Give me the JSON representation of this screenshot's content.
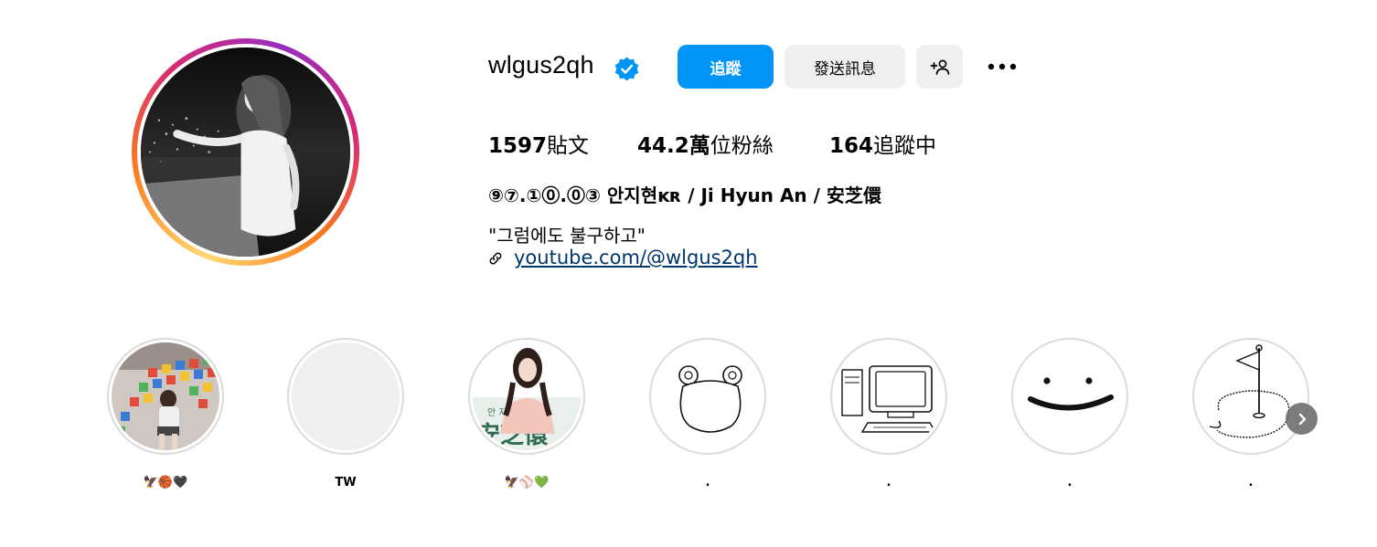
{
  "profile": {
    "username": "wlgus2qh",
    "verified": true,
    "accent_color": "#0095f6"
  },
  "actions": {
    "follow_label": "追蹤",
    "message_label": "發送訊息",
    "add_user_icon": "add-user-icon",
    "more_icon": "more-options-icon"
  },
  "stats": {
    "posts_count": "1597",
    "posts_label": "貼文",
    "followers_count": "44.2萬",
    "followers_label": "位粉絲",
    "following_count": "164",
    "following_label": "追蹤中"
  },
  "bio": {
    "name": "⑨⑦.①⓪.⓪③ 안지현ᴋʀ / Ji Hyun An / 安芝儇",
    "text": "\"그럼에도 불구하고\"",
    "link": "youtube.com/@wlgus2qh",
    "link_color": "#00376b"
  },
  "highlights": [
    {
      "label": "🦅🏀🖤",
      "cover": "stadium-photo"
    },
    {
      "label": "TW",
      "cover": "blank-gray"
    },
    {
      "label": "🦅⚾💚",
      "cover": "portrait-photo"
    },
    {
      "label": ".",
      "cover": "bear-drawing"
    },
    {
      "label": ".",
      "cover": "computer-drawing"
    },
    {
      "label": ".",
      "cover": "smiley-drawing"
    },
    {
      "label": ".",
      "cover": "golf-flag-drawing"
    }
  ]
}
